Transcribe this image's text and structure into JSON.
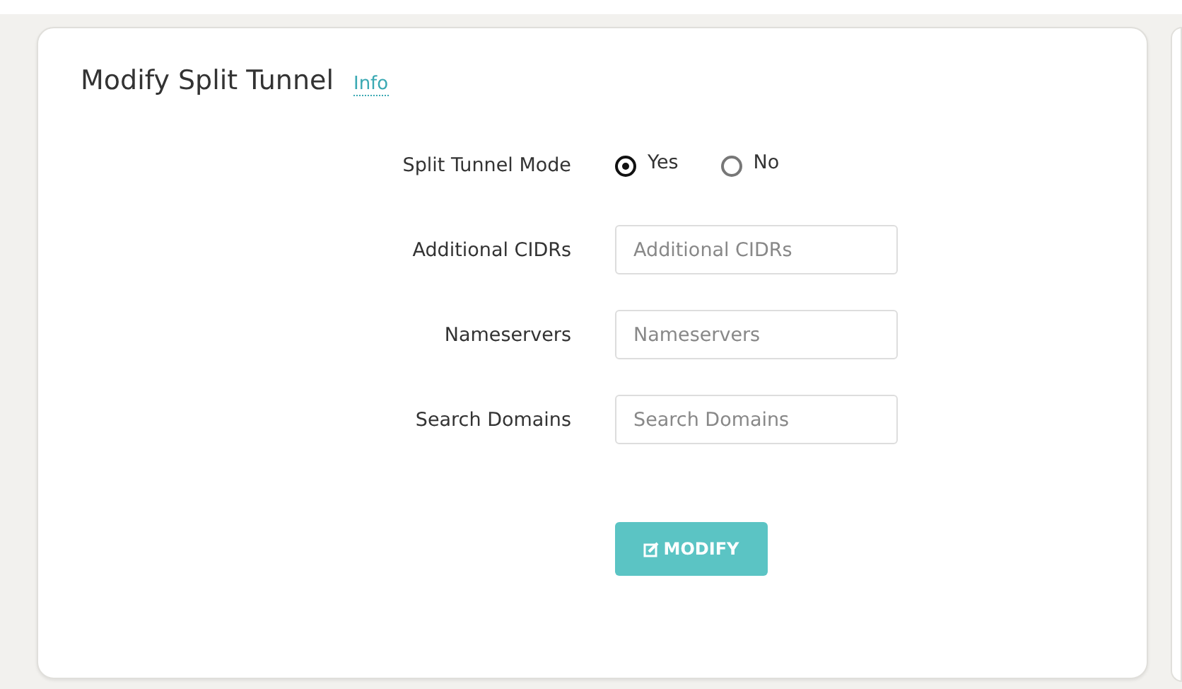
{
  "title": "Modify Split Tunnel",
  "info_link": "Info",
  "fields": [
    {
      "kind": "radio",
      "label": "Split Tunnel Mode",
      "options": [
        {
          "label": "Yes",
          "selected": true
        },
        {
          "label": "No",
          "selected": false
        }
      ]
    },
    {
      "kind": "text",
      "label": "Additional CIDRs",
      "placeholder": "Additional CIDRs"
    },
    {
      "kind": "text",
      "label": "Nameservers",
      "placeholder": "Nameservers"
    },
    {
      "kind": "text",
      "label": "Search Domains",
      "placeholder": "Search Domains"
    }
  ],
  "button": "MODIFY"
}
